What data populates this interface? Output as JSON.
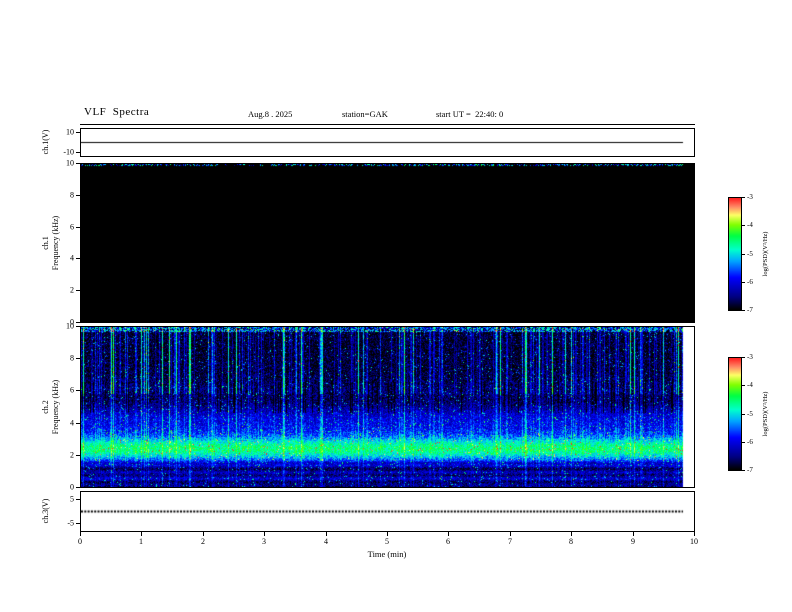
{
  "header": {
    "title": "VLF  Spectra",
    "date": "Aug.8 . 2025",
    "station": "station=GAK",
    "start_ut": "start UT =  22:40: 0"
  },
  "panels": {
    "ch1v": {
      "ylabel": "ch.1(V)"
    },
    "ch1spec": {
      "ylabel_line1": "ch.1",
      "ylabel_line2": "Frequency (kHz)"
    },
    "ch2spec": {
      "ylabel_line1": "ch.2",
      "ylabel_line2": "Frequency (kHz)"
    },
    "ch3v": {
      "ylabel": "ch.3(V)"
    }
  },
  "axes": {
    "time_label": "Time (min)",
    "time_ticks": [
      0,
      1,
      2,
      3,
      4,
      5,
      6,
      7,
      8,
      9,
      10
    ],
    "freq_ticks": [
      10,
      8,
      6,
      4,
      2,
      0
    ],
    "ch1v_ticks": [
      10,
      -10
    ],
    "ch3v_ticks": [
      5,
      -5
    ],
    "colorbar_ticks": [
      -3,
      -4,
      -5,
      -6,
      -7
    ]
  },
  "colorbar": {
    "label": "log(PSD)(V²/Hz)",
    "ticks": [
      -3,
      -4,
      -5,
      -6,
      -7
    ],
    "colormap_stops": [
      [
        "#000000",
        -7
      ],
      [
        "#000080",
        -6.55
      ],
      [
        "#0000ff",
        -5.85
      ],
      [
        "#00a8ff",
        -5.25
      ],
      [
        "#00ffcc",
        -4.85
      ],
      [
        "#00ff44",
        -4.35
      ],
      [
        "#80ff00",
        -3.95
      ],
      [
        "#ffff66",
        -3.6
      ],
      [
        "#ff8866",
        -3.3
      ],
      [
        "#ff2222",
        -3
      ]
    ]
  },
  "chart_data": [
    {
      "type": "line",
      "panel": "ch.1(V)",
      "ylabel": "ch.1(V)",
      "ylim": [
        -10,
        10
      ],
      "yticks": [
        10,
        -10
      ],
      "xlim": [
        0,
        10
      ],
      "x_extent_min": [
        0,
        9.8
      ],
      "series": [
        {
          "name": "ch.1 voltage",
          "value_volts": 0,
          "shape": "flat line at ~0 V for full record"
        }
      ]
    },
    {
      "type": "heatmap",
      "panel": "ch.1 spectrogram",
      "ylabel": "Frequency (kHz)",
      "ylim": [
        0,
        10
      ],
      "yticks": [
        10,
        8,
        6,
        4,
        2,
        0
      ],
      "xlim": [
        0,
        10
      ],
      "value_scale": "log(PSD)(V²/Hz)",
      "value_range": [
        -7,
        -3
      ],
      "content": "uniform near noise floor (~ -7, renders black) over 0-10 kHz for the entire 10 min; sparse colored speckle along the 10 kHz top edge"
    },
    {
      "type": "heatmap",
      "panel": "ch.2 spectrogram",
      "ylabel": "Frequency (kHz)",
      "ylim": [
        0,
        10
      ],
      "yticks": [
        10,
        8,
        6,
        4,
        2,
        0
      ],
      "xlim": [
        0,
        10
      ],
      "value_scale": "log(PSD)(V²/Hz)",
      "value_range": [
        -7,
        -3
      ],
      "content": [
        "persistent bright green band near 2-3 kHz (~ -4.7)",
        "blue noise background (~ -6.3) below ~5 kHz",
        "weaker cyan-blue enhancement near 3.5-4.5 kHz",
        "dark navy band near 5-6 kHz",
        "near-black background above ~6.5 kHz (~ -6.8)",
        "dense vertical sferic streaks (cyan/green), strongest above 6 kHz",
        "speckled green/yellow line along the 10 kHz top edge",
        "dark horizontal striping below ~1.5 kHz"
      ]
    },
    {
      "type": "line",
      "panel": "ch.3(V)",
      "ylabel": "ch.3(V)",
      "ylim": [
        -5,
        5
      ],
      "yticks": [
        5,
        -5
      ],
      "xlim": [
        0,
        10
      ],
      "x_extent_min": [
        0,
        9.8
      ],
      "series": [
        {
          "name": "ch.3 voltage",
          "value_volts": 0,
          "shape": "flat thick dotted trace at ~0 V"
        }
      ]
    }
  ]
}
